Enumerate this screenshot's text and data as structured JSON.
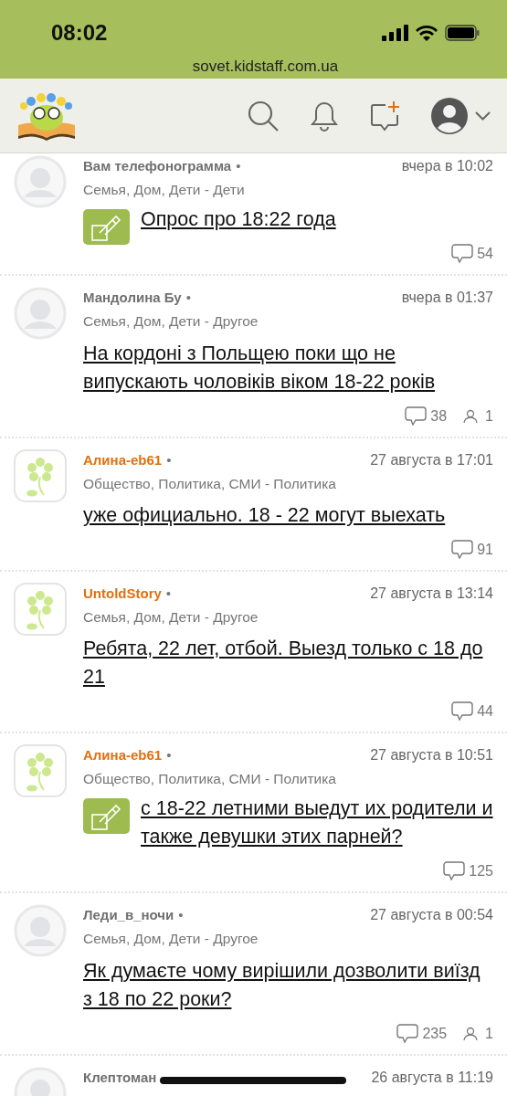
{
  "status_bar": {
    "time": "08:02",
    "url": "sovet.kidstaff.com.ua"
  },
  "posts": [
    {
      "author": "Вам телефонограмма",
      "color": "#707070",
      "kind": "generic",
      "dot": "•",
      "time": "вчера в 10:02",
      "category": "Семья, Дом, Дети - Дети",
      "poll": true,
      "title": "Опрос про 18:22 года",
      "comments": "54"
    },
    {
      "author": "Мандолина Бу",
      "color": "#707070",
      "kind": "generic",
      "dot": "•",
      "time": "вчера в 01:37",
      "category": "Семья, Дом, Дети - Другое",
      "poll": false,
      "title": "На кордоні з Польщею поки що не випускають чоловіків віком 18-22 років",
      "comments": "38",
      "participants": "1"
    },
    {
      "author": "Алина-eb61",
      "color": "#e0700f",
      "kind": "flower",
      "dot": "•",
      "time": "27 августа в 17:01",
      "category": "Общество, Политика, СМИ - Политика",
      "poll": false,
      "title": "уже официально. 18 - 22 могут выехать",
      "comments": "91"
    },
    {
      "author": "UntoldStory",
      "color": "#e0700f",
      "kind": "flower",
      "dot": "•",
      "time": "27 августа в 13:14",
      "category": "Семья, Дом, Дети - Другое",
      "poll": false,
      "title": "Ребята, 22 лет, отбой. Выезд только с 18 до 21",
      "comments": "44"
    },
    {
      "author": "Алина-eb61",
      "color": "#e0700f",
      "kind": "flower",
      "dot": "•",
      "time": "27 августа в 10:51",
      "category": "Общество, Политика, СМИ - Политика",
      "poll": true,
      "title": "с 18-22 летними выедут их родители и также девушки этих парней?",
      "comments": "125"
    },
    {
      "author": "Леди_в_ночи",
      "color": "#707070",
      "kind": "generic",
      "dot": "•",
      "time": "27 августа в 00:54",
      "category": "Семья, Дом, Дети - Другое",
      "poll": false,
      "title": "Як думаєте чому вирішили дозволити виїзд з 18 по 22 роки?",
      "comments": "235",
      "participants": "1"
    },
    {
      "author": "Клептоман",
      "color": "#707070",
      "kind": "generic",
      "time": "26 августа в 11:19"
    }
  ]
}
